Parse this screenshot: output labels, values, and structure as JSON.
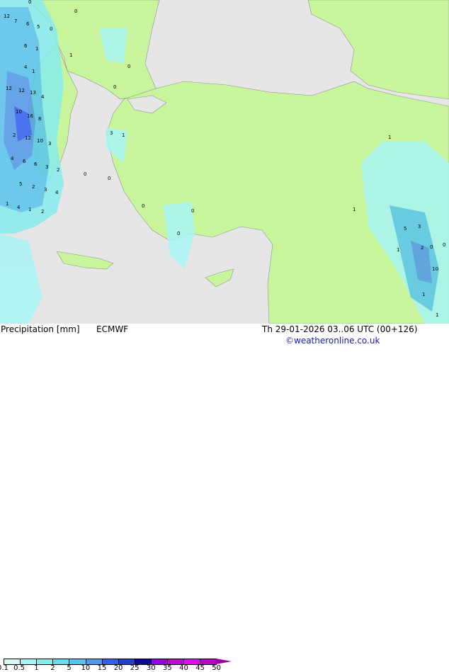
{
  "title": "Precipitation [mm]",
  "model": "ECMWF",
  "valid": "Th 29-01-2026 03..06 UTC (00+126)",
  "credit": "©weatheronline.co.uk",
  "colors": {
    "sea": "#e6e6e6",
    "land": "#c8f59c",
    "coast": "#909090"
  },
  "legend": {
    "labels": [
      "0.1",
      "0.5",
      "1",
      "2",
      "5",
      "10",
      "15",
      "20",
      "25",
      "30",
      "35",
      "40",
      "45",
      "50"
    ],
    "colors": [
      "#d8f8f8",
      "#a8f4f4",
      "#88ecec",
      "#68dcec",
      "#58c4ec",
      "#5098e8",
      "#3060f0",
      "#2040c8",
      "#0808a0",
      "#9000e8",
      "#c000e8",
      "#f000f0",
      "#c000c0"
    ],
    "arrow_color": "#a000a0"
  },
  "map_values": [
    "12",
    "7",
    "6",
    "5",
    "6",
    "1",
    "4",
    "1",
    "12",
    "12",
    "13",
    "4",
    "10",
    "16",
    "8",
    "2",
    "12",
    "10",
    "3",
    "4",
    "6",
    "6",
    "3",
    "2",
    "5",
    "2",
    "3",
    "4",
    "1",
    "4",
    "1",
    "2",
    "0",
    "0",
    "0",
    "1",
    "0",
    "0",
    "3",
    "1",
    "0",
    "0",
    "0",
    "0",
    "0",
    "1",
    "1",
    "5",
    "3",
    "1",
    "2",
    "10",
    "0",
    "1",
    "0",
    "1"
  ]
}
